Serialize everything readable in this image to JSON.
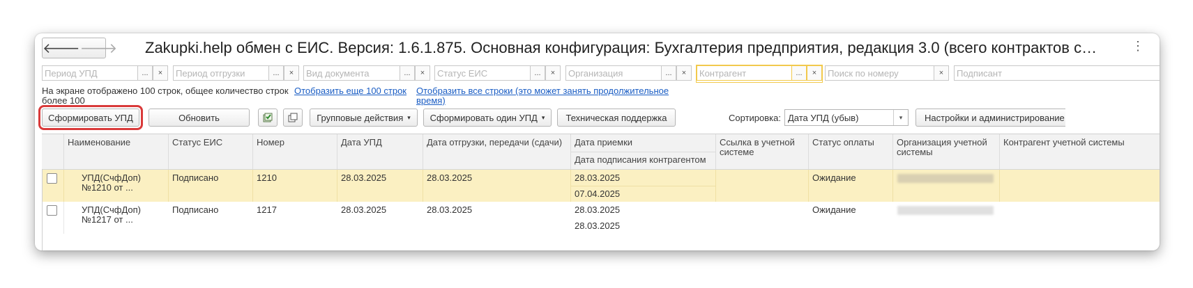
{
  "window": {
    "title": "Zakupki.help обмен с ЕИС. Версия: 1.6.1.875. Основная конфигурация: Бухгалтерия предприятия, редакция 3.0 (всего контрактов с…",
    "nav": {
      "back": "🡐",
      "forward": "🡒"
    },
    "more_icon": "⋮"
  },
  "filters": [
    {
      "placeholder": "Период УПД",
      "btn1": "...",
      "btn2": "×"
    },
    {
      "placeholder": "Период отгрузки",
      "btn1": "...",
      "btn2": "×"
    },
    {
      "placeholder": "Вид документа",
      "btn1": "...",
      "btn2": "×"
    },
    {
      "placeholder": "Статус ЕИС",
      "btn1": "...",
      "btn2": "×"
    },
    {
      "placeholder": "Организация",
      "btn1": "...",
      "btn2": "×"
    },
    {
      "placeholder": "Контрагент",
      "btn1": "...",
      "btn2": "×"
    },
    {
      "placeholder": "Поиск по номеру",
      "btn2": "×"
    },
    {
      "placeholder": "Подписант"
    }
  ],
  "info": {
    "text": "На экране отображено 100 строк, общее количество строк более 100",
    "show_more_link": "Отобразить еще 100 строк",
    "show_all_link": "Отобразить все строки (это может занять продолжительное время)"
  },
  "toolbar": {
    "form_upd": "Сформировать УПД",
    "refresh": "Обновить",
    "group_actions": "Групповые действия",
    "form_one_upd": "Сформировать один УПД",
    "support": "Техническая поддержка",
    "sort_label": "Сортировка:",
    "sort_value": "Дата УПД (убыв)",
    "settings": "Настройки и администрирование",
    "dropdown_arrow": "▾",
    "highlight_color": "#d93a3a"
  },
  "table": {
    "headers": {
      "name": "Наименование",
      "status_eis": "Статус ЕИС",
      "number": "Номер",
      "date_upd": "Дата УПД",
      "date_ship": "Дата отгрузки, передачи (сдачи)",
      "date_accept": "Дата приемки",
      "date_sign": "Дата подписания контрагентом",
      "link": "Ссылка в учетной системе",
      "pay_status": "Статус оплаты",
      "org": "Организация учетной системы",
      "contractor": "Контрагент учетной системы"
    },
    "rows": [
      {
        "name": "УПД(СчфДоп) №1210 от ...",
        "status_eis": "Подписано",
        "number": "1210",
        "date_upd": "28.03.2025",
        "date_ship": "28.03.2025",
        "date_accept": "28.03.2025",
        "date_sign": "07.04.2025",
        "link": "",
        "pay_status": "Ожидание"
      },
      {
        "name": "УПД(СчфДоп) №1217 от ...",
        "status_eis": "Подписано",
        "number": "1217",
        "date_upd": "28.03.2025",
        "date_ship": "28.03.2025",
        "date_accept": "28.03.2025",
        "date_sign": "28.03.2025",
        "link": "",
        "pay_status": "Ожидание"
      }
    ]
  }
}
